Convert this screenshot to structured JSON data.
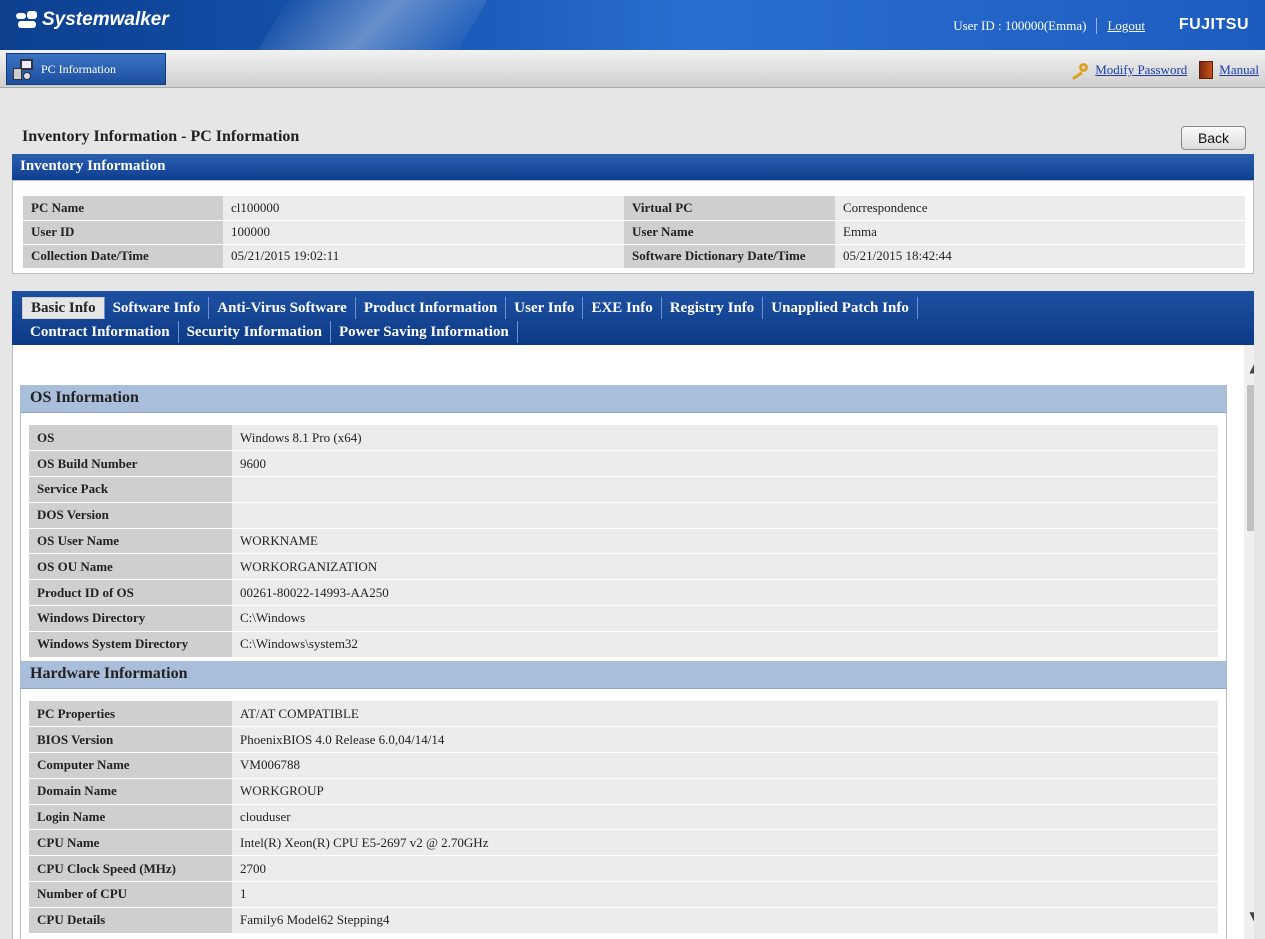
{
  "header": {
    "app_name": "Systemwalker",
    "user_text": "User ID : 100000(Emma)",
    "logout": "Logout",
    "brand": "FUJITSU"
  },
  "subheader": {
    "tab_label": "PC Information",
    "modify_password": "Modify Password",
    "manual": "Manual"
  },
  "page": {
    "title": "Inventory Information - PC Information",
    "back": "Back"
  },
  "inventory": {
    "header": "Inventory Information",
    "rows": [
      {
        "k1": "PC Name",
        "v1": "cl100000",
        "k2": "Virtual PC",
        "v2": "Correspondence"
      },
      {
        "k1": "User ID",
        "v1": "100000",
        "k2": "User Name",
        "v2": "Emma"
      },
      {
        "k1": "Collection Date/Time",
        "v1": "05/21/2015 19:02:11",
        "k2": "Software Dictionary Date/Time",
        "v2": "05/21/2015 18:42:44"
      }
    ]
  },
  "tabs": {
    "row1": [
      "Basic Info",
      "Software Info",
      "Anti-Virus Software",
      "Product Information",
      "User Info",
      "EXE Info",
      "Registry Info",
      "Unapplied Patch Info"
    ],
    "row2": [
      "Contract Information",
      "Security Information",
      "Power Saving Information"
    ],
    "active": "Basic Info"
  },
  "os_section": {
    "title": "OS Information",
    "rows": [
      {
        "k": "OS",
        "v": "Windows 8.1 Pro (x64)"
      },
      {
        "k": "OS Build Number",
        "v": "9600"
      },
      {
        "k": "Service Pack",
        "v": ""
      },
      {
        "k": "DOS Version",
        "v": ""
      },
      {
        "k": "OS User Name",
        "v": "WORKNAME"
      },
      {
        "k": "OS OU Name",
        "v": "WORKORGANIZATION"
      },
      {
        "k": "Product ID of OS",
        "v": "00261-80022-14993-AA250"
      },
      {
        "k": "Windows Directory",
        "v": "C:\\Windows"
      },
      {
        "k": "Windows System Directory",
        "v": "C:\\Windows\\system32"
      }
    ]
  },
  "hw_section": {
    "title": "Hardware Information",
    "rows": [
      {
        "k": "PC Properties",
        "v": "AT/AT COMPATIBLE"
      },
      {
        "k": "BIOS Version",
        "v": "PhoenixBIOS 4.0 Release 6.0,04/14/14"
      },
      {
        "k": "Computer Name",
        "v": "VM006788"
      },
      {
        "k": "Domain Name",
        "v": "WORKGROUP"
      },
      {
        "k": "Login Name",
        "v": "clouduser"
      },
      {
        "k": "CPU Name",
        "v": "Intel(R) Xeon(R) CPU E5-2697 v2 @ 2.70GHz"
      },
      {
        "k": "CPU Clock Speed (MHz)",
        "v": "2700"
      },
      {
        "k": "Number of CPU",
        "v": "1"
      },
      {
        "k": "CPU Details",
        "v": "Family6 Model62 Stepping4"
      }
    ]
  }
}
